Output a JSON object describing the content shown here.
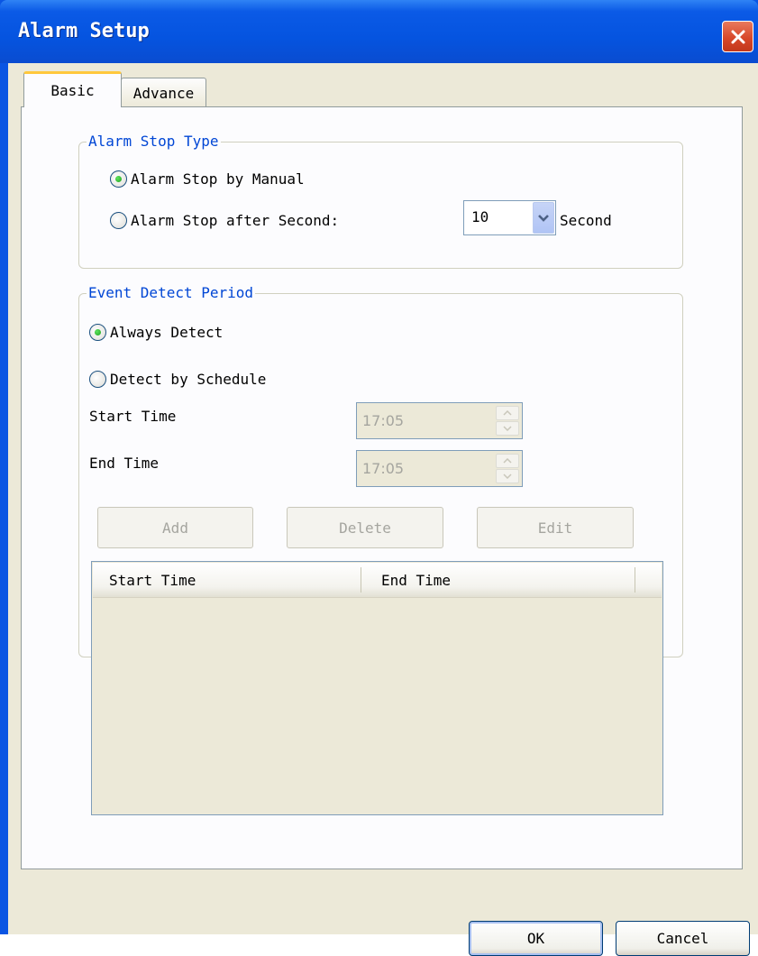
{
  "window": {
    "title": "Alarm Setup"
  },
  "tabs": [
    {
      "label": "Basic",
      "selected": true
    },
    {
      "label": "Advance",
      "selected": false
    }
  ],
  "alarm_stop": {
    "group_title": "Alarm Stop Type",
    "option_manual": "Alarm Stop by Manual",
    "option_after": "Alarm Stop after Second:",
    "selected": "manual",
    "seconds_value": "10",
    "seconds_unit": "Second"
  },
  "event_detect": {
    "group_title": "Event Detect Period",
    "option_always": "Always Detect",
    "option_schedule": "Detect by Schedule",
    "selected": "always",
    "start_time_label": "Start Time",
    "start_time_value": "17:05",
    "end_time_label": "End Time",
    "end_time_value": "17:05",
    "add_label": "Add",
    "delete_label": "Delete",
    "edit_label": "Edit",
    "columns": [
      "Start Time",
      "End Time"
    ],
    "rows": []
  },
  "footer": {
    "ok_label": "OK",
    "cancel_label": "Cancel"
  },
  "colors": {
    "titlebar": "#0554e0",
    "dialog_bg": "#ece9d8",
    "group_title": "#0046d5",
    "disabled_text": "#a5a59f"
  },
  "icons": {
    "close": "close-icon",
    "dropdown": "chevron-down-icon",
    "spin_up": "arrow-up-icon",
    "spin_down": "arrow-down-icon"
  }
}
